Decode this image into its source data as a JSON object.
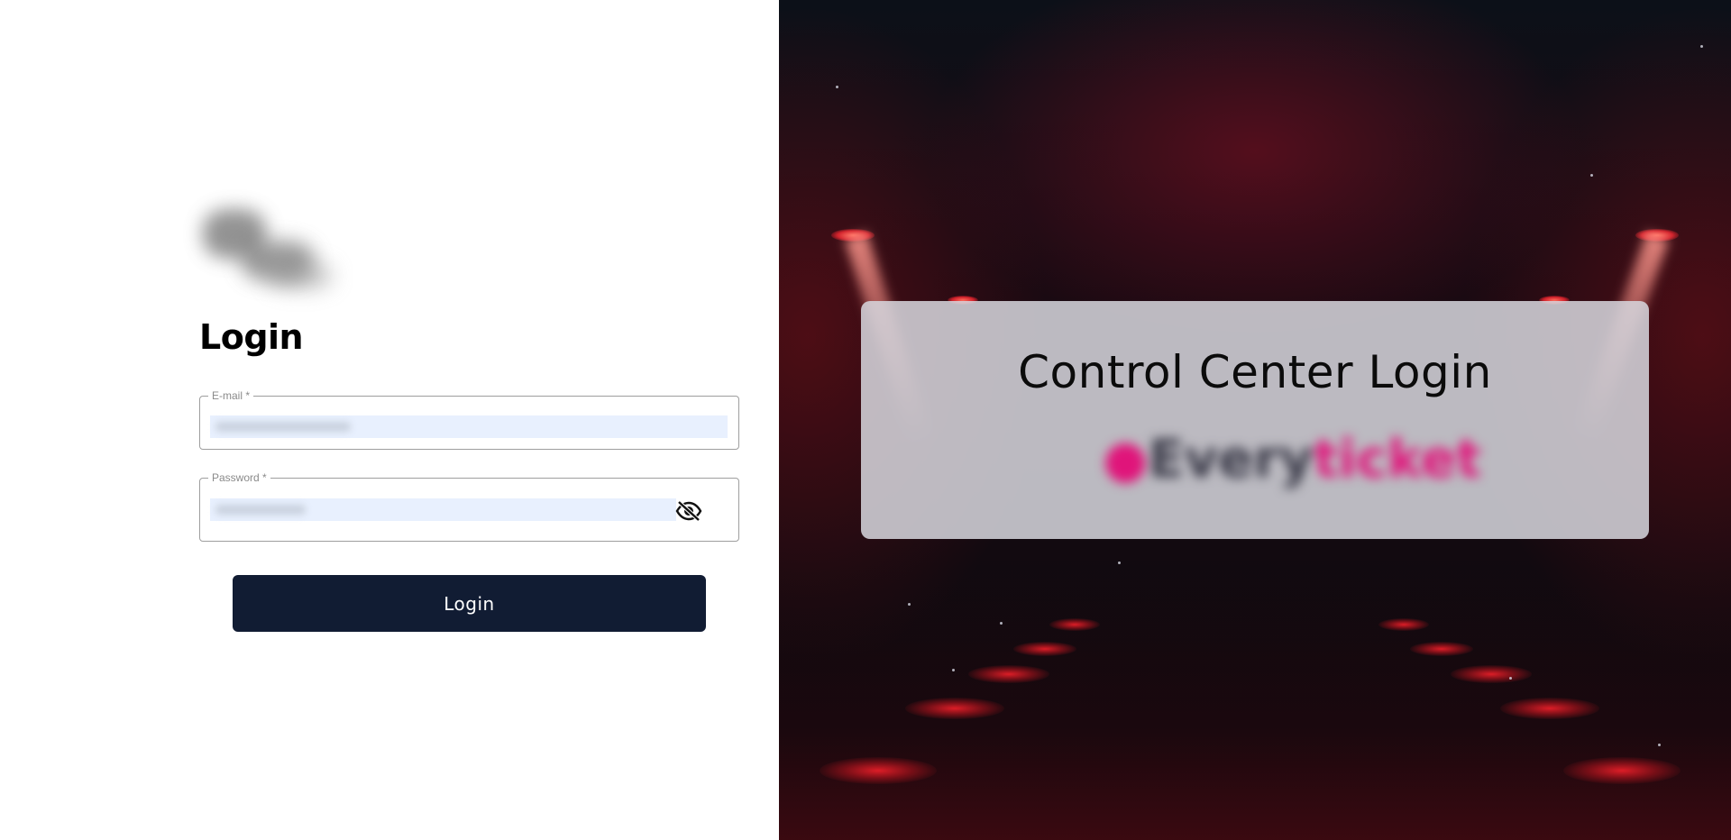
{
  "login_panel": {
    "logo_icon": "company-logo-blurred",
    "heading": "Login",
    "email": {
      "label": "E-mail *",
      "value": "",
      "state": "autofilled-blurred"
    },
    "password": {
      "label": "Password *",
      "value": "",
      "state": "autofilled-blurred",
      "visibility_icon": "eye-off-icon"
    },
    "submit_label": "Login"
  },
  "hero_panel": {
    "card_title": "Control Center Login",
    "brand_logo": {
      "part1": "●",
      "part2": "Every",
      "part3": "ticket"
    },
    "background": "red-stage-spotlights"
  },
  "colors": {
    "button_bg": "#111c33",
    "input_autofill_bg": "#e8f0fe",
    "brand_pink": "#e0147a",
    "stage_red": "#d0202a"
  }
}
